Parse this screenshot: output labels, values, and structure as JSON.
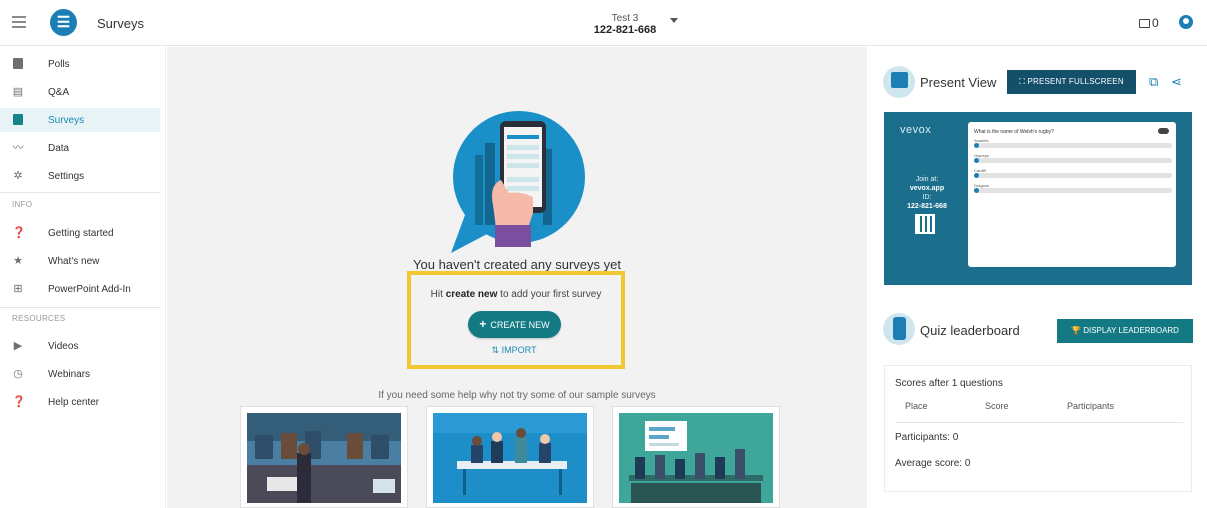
{
  "header": {
    "app_title": "Surveys",
    "session_name": "Test 3",
    "session_code": "122-821-668",
    "device_count": "0"
  },
  "sidebar": {
    "items": [
      {
        "label": "Polls",
        "icon": "polls-icon"
      },
      {
        "label": "Q&A",
        "icon": "qa-icon"
      },
      {
        "label": "Surveys",
        "icon": "surveys-icon",
        "active": true
      },
      {
        "label": "Data",
        "icon": "chart-line-icon"
      },
      {
        "label": "Settings",
        "icon": "gear-icon"
      }
    ],
    "info_label": "INFO",
    "info_items": [
      {
        "label": "Getting started",
        "icon": "question-icon"
      },
      {
        "label": "What's new",
        "icon": "star-icon"
      },
      {
        "label": "PowerPoint Add-In",
        "icon": "plus-box-icon"
      }
    ],
    "resources_label": "RESOURCES",
    "resources_items": [
      {
        "label": "Videos",
        "icon": "video-icon"
      },
      {
        "label": "Webinars",
        "icon": "clock-icon"
      },
      {
        "label": "Help center",
        "icon": "question-icon"
      }
    ]
  },
  "main": {
    "empty_title": "You haven't created any surveys yet",
    "hint_prefix": "Hit",
    "hint_bold": "create new",
    "hint_suffix": "to add your first survey",
    "create_label": "CREATE NEW",
    "import_label": "IMPORT",
    "sample_hint": "If you need some help why not try some of our sample surveys",
    "highlight_color": "#f2c72f"
  },
  "present": {
    "title": "Present View",
    "fullscreen_label": "PRESENT FULLSCREEN",
    "preview": {
      "brand": "vevox",
      "join_prefix": "Join at:",
      "join_url": "vevox.app",
      "id_label": "ID:",
      "id_value": "122-821-668",
      "question": "What is the name of Welsh's rugby?",
      "options": [
        "Scarlets",
        "Ospreys",
        "Cardiff",
        "Dragons"
      ]
    }
  },
  "leaderboard": {
    "title": "Quiz leaderboard",
    "display_label": "DISPLAY LEADERBOARD",
    "scores_after": "Scores after 1 questions",
    "col_place": "Place",
    "col_score": "Score",
    "col_participants": "Participants",
    "participants_line": "Participants: 0",
    "average_line": "Average score: 0"
  },
  "colors": {
    "teal": "#137a83",
    "dark_blue": "#15506b",
    "brand_blue": "#1b7fb6",
    "preview_bg": "#1b6f8d"
  }
}
